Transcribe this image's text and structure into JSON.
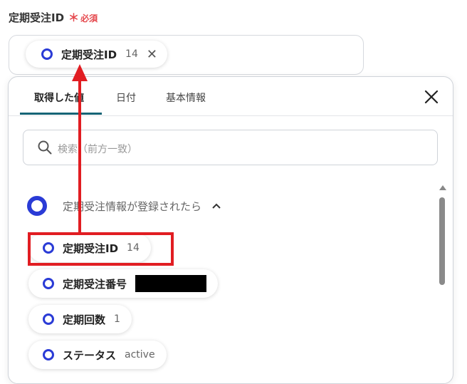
{
  "field": {
    "label": "定期受注ID",
    "required_mark": "＊",
    "required_text": "必須"
  },
  "selected_chip": {
    "label": "定期受注ID",
    "value": "14",
    "remove_icon": "close-icon"
  },
  "tabs": [
    {
      "label": "取得した値",
      "active": true
    },
    {
      "label": "日付",
      "active": false
    },
    {
      "label": "基本情報",
      "active": false
    }
  ],
  "search": {
    "placeholder": "検索（前方一致）"
  },
  "group": {
    "label": "定期受注情報が登録されたら",
    "icon": "ring-icon",
    "expanded": true
  },
  "items": [
    {
      "label": "定期受注ID",
      "value": "14"
    },
    {
      "label": "定期受注番号",
      "value": ""
    },
    {
      "label": "定期回数",
      "value": "1"
    },
    {
      "label": "ステータス",
      "value": "active"
    }
  ],
  "colors": {
    "accent_ring": "#2a3bd6",
    "tab_underline": "#166476",
    "annotation_red": "#e11d22",
    "required": "#e5484d"
  }
}
